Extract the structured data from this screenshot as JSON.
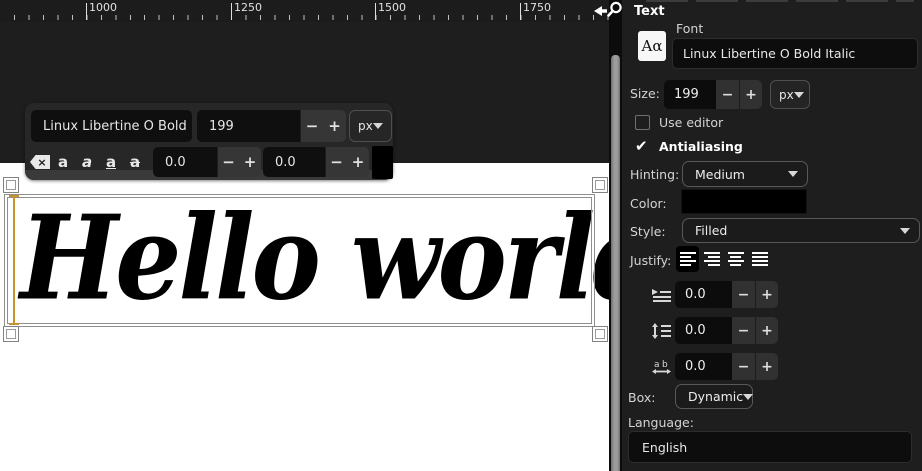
{
  "ruler": {
    "labels": [
      "1000",
      "1250",
      "1500",
      "1750"
    ]
  },
  "canvas": {
    "text_content": "Hello world",
    "text_color": "#000000",
    "caret_color": "#c8922a"
  },
  "float_toolbar": {
    "font_value": "Linux Libertine O Bold",
    "size_value": "199",
    "unit_value": "px",
    "minus": "−",
    "plus": "+",
    "baseline_value": "0.0",
    "kerning_value": "0.0",
    "swatch_color": "#000000",
    "icons": {
      "clear": "×",
      "bold": "a",
      "italic": "a",
      "underline": "a",
      "strikethrough": "a"
    }
  },
  "panel": {
    "title": "Text",
    "font_label": "Font",
    "font_preview": "Aα",
    "font_value": "Linux Libertine O Bold Italic",
    "size_label": "Size:",
    "size_value": "199",
    "unit_value": "px",
    "minus": "−",
    "plus": "+",
    "use_editor_label": "Use editor",
    "antialiasing_label": "Antialiasing",
    "hinting_label": "Hinting:",
    "hinting_value": "Medium",
    "color_label": "Color:",
    "color_value": "#000000",
    "style_label": "Style:",
    "style_value": "Filled",
    "justify_label": "Justify:",
    "indent_value": "0.0",
    "line_spacing_value": "0.0",
    "letter_spacing_value": "0.0",
    "box_label": "Box:",
    "box_value": "Dynamic",
    "language_label": "Language:",
    "language_value": "English"
  }
}
